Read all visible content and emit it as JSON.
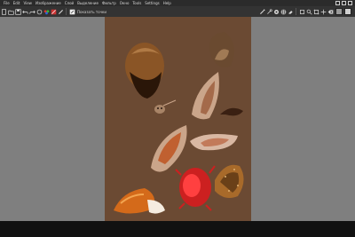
{
  "menubar": {
    "items": [
      "File",
      "Edit",
      "View",
      "Изображение",
      "Слой",
      "Выделение",
      "Фильтр",
      "Окно",
      "Tools",
      "Settings",
      "Help"
    ]
  },
  "toolbar": {
    "label": "Показать точки",
    "tools": [
      "new-icon",
      "open-icon",
      "save-icon",
      "undo-icon",
      "redo-icon",
      "transform-icon",
      "palette-icon",
      "brush-icon",
      "pencil-icon",
      "eraser-icon"
    ],
    "right_tools": [
      "eyedropper-icon",
      "brush-settings-icon",
      "fill-icon",
      "gradient-icon",
      "eraser-tool-icon",
      "transform-tool-icon",
      "zoom-icon",
      "crop-icon",
      "move-icon",
      "close-tab-icon"
    ],
    "swatches": [
      "#9a9a9a",
      "#cfcfcf"
    ]
  },
  "colors": {
    "canvas_bg": "#6b4a33",
    "workspace": "#7f7f7f",
    "toolbar": "#333333",
    "menubar": "#2b2b2b",
    "statusbar": "#111111"
  }
}
